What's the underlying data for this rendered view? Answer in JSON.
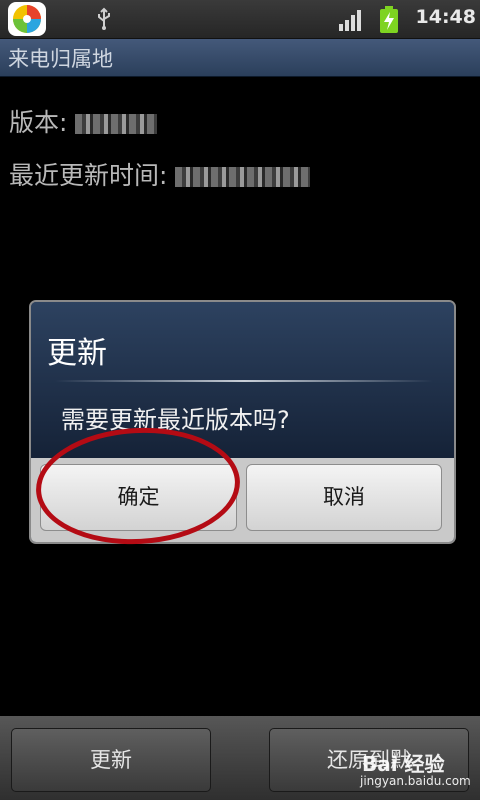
{
  "status_bar": {
    "time": "14:48",
    "app_icon": "colorful-app-icon",
    "icons": [
      "usb-icon",
      "signal-icon",
      "battery-charging-icon"
    ]
  },
  "app_title": "来电归属地",
  "info": {
    "version_label": "版本:",
    "last_update_label": "最近更新时间:"
  },
  "dialog": {
    "title": "更新",
    "message": "需要更新最近版本吗?",
    "ok_label": "确定",
    "cancel_label": "取消"
  },
  "bottom_bar": {
    "update_label": "更新",
    "restore_label": "还原到默"
  },
  "watermark": {
    "brand": "Bai 经验",
    "url": "jingyan.baidu.com"
  },
  "colors": {
    "highlight_ellipse": "#b40b14",
    "title_bar": "#3a4e6c",
    "dialog_header": "#1f3150"
  }
}
